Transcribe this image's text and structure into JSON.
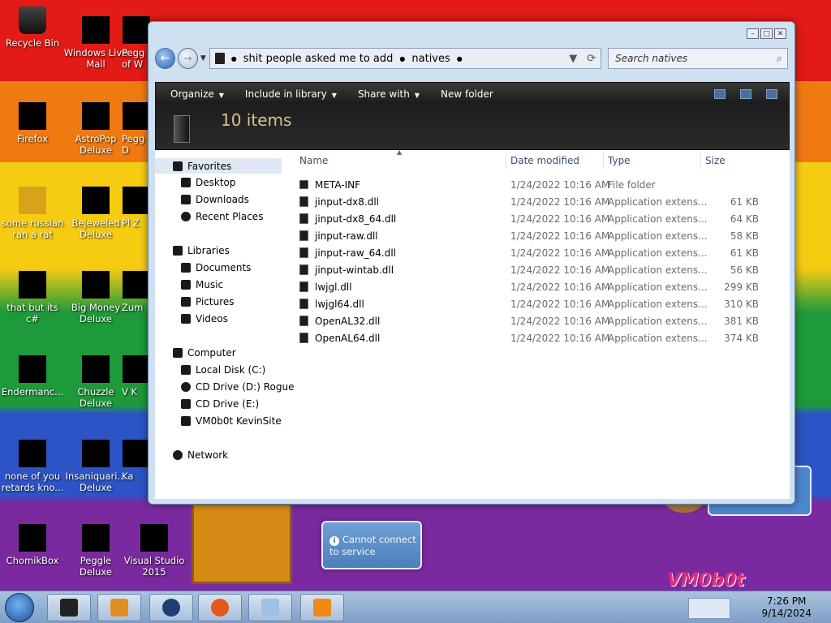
{
  "desktop": {
    "icons": [
      {
        "label": "Recycle Bin"
      },
      {
        "label": "Windows Live Mail"
      },
      {
        "label": "Pegg of W"
      },
      {
        "label": "Firefox"
      },
      {
        "label": "AstroPop Deluxe"
      },
      {
        "label": "Pegg D"
      },
      {
        "label": "some russian ran a rat"
      },
      {
        "label": "Bejeweled Deluxe"
      },
      {
        "label": "Pl Z"
      },
      {
        "label": "that but its c#"
      },
      {
        "label": "Big Money Deluxe"
      },
      {
        "label": "Zum"
      },
      {
        "label": "Endermanc..."
      },
      {
        "label": "Chuzzle Deluxe"
      },
      {
        "label": "V K"
      },
      {
        "label": "none of you retards kno..."
      },
      {
        "label": "Insaniquari... Deluxe"
      },
      {
        "label": "Ka"
      },
      {
        "label": "ChomikBox"
      },
      {
        "label": "Peggle Deluxe"
      },
      {
        "label": "Visual Studio 2015"
      }
    ],
    "notification": "Cannot connect to service",
    "brand_text": "VM0b0t"
  },
  "explorer": {
    "address": {
      "path": [
        "shit people asked me to add",
        "natives"
      ]
    },
    "search_placeholder": "Search natives",
    "toolbar": {
      "organize": "Organize",
      "include": "Include in library",
      "share": "Share with",
      "new_folder": "New folder"
    },
    "items_count": "10 items",
    "nav": {
      "favorites": "Favorites",
      "desktop": "Desktop",
      "downloads": "Downloads",
      "recent": "Recent Places",
      "libraries": "Libraries",
      "documents": "Documents",
      "music": "Music",
      "pictures": "Pictures",
      "videos": "Videos",
      "computer": "Computer",
      "local_disk": "Local Disk (C:)",
      "cd_d": "CD Drive (D:) Rogue",
      "cd_e": "CD Drive (E:)",
      "vm": "VM0b0t KevinSite",
      "network": "Network"
    },
    "columns": {
      "name": "Name",
      "date": "Date modified",
      "type": "Type",
      "size": "Size"
    },
    "files": [
      {
        "name": "META-INF",
        "date": "1/24/2022 10:16 AM",
        "type": "File folder",
        "size": ""
      },
      {
        "name": "jinput-dx8.dll",
        "date": "1/24/2022 10:16 AM",
        "type": "Application extens...",
        "size": "61 KB"
      },
      {
        "name": "jinput-dx8_64.dll",
        "date": "1/24/2022 10:16 AM",
        "type": "Application extens...",
        "size": "64 KB"
      },
      {
        "name": "jinput-raw.dll",
        "date": "1/24/2022 10:16 AM",
        "type": "Application extens...",
        "size": "58 KB"
      },
      {
        "name": "jinput-raw_64.dll",
        "date": "1/24/2022 10:16 AM",
        "type": "Application extens...",
        "size": "61 KB"
      },
      {
        "name": "jinput-wintab.dll",
        "date": "1/24/2022 10:16 AM",
        "type": "Application extens...",
        "size": "56 KB"
      },
      {
        "name": "lwjgl.dll",
        "date": "1/24/2022 10:16 AM",
        "type": "Application extens...",
        "size": "299 KB"
      },
      {
        "name": "lwjgl64.dll",
        "date": "1/24/2022 10:16 AM",
        "type": "Application extens...",
        "size": "310 KB"
      },
      {
        "name": "OpenAL32.dll",
        "date": "1/24/2022 10:16 AM",
        "type": "Application extens...",
        "size": "381 KB"
      },
      {
        "name": "OpenAL64.dll",
        "date": "1/24/2022 10:16 AM",
        "type": "Application extens...",
        "size": "374 KB"
      }
    ]
  },
  "taskbar": {
    "time": "7:26 PM",
    "date": "9/14/2024"
  }
}
